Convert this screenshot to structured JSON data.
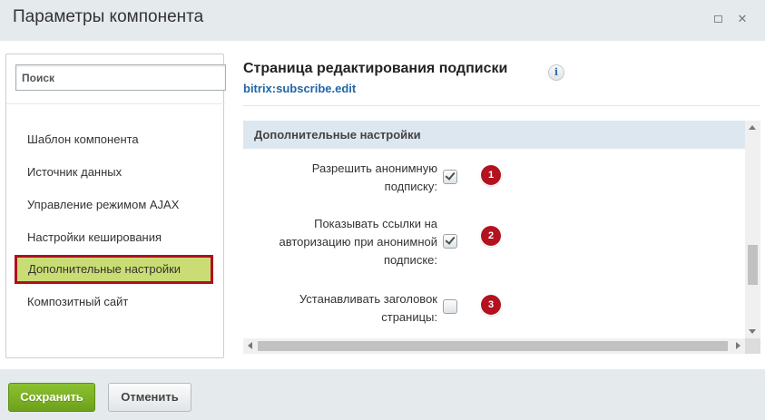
{
  "window": {
    "title": "Параметры компонента",
    "maximize_icon": "maximize-icon",
    "close_icon": "close-icon",
    "close_glyph": "✕"
  },
  "sidebar": {
    "search_placeholder": "Поиск",
    "items": [
      {
        "label": "Шаблон компонента"
      },
      {
        "label": "Источник данных"
      },
      {
        "label": "Управление режимом AJAX"
      },
      {
        "label": "Настройки кеширования"
      },
      {
        "label": "Дополнительные настройки",
        "active": true
      },
      {
        "label": "Композитный сайт"
      }
    ]
  },
  "component": {
    "title": "Страница редактирования подписки",
    "code": "bitrix:subscribe.edit",
    "info_glyph": "i"
  },
  "section": {
    "title": "Дополнительные настройки",
    "properties": [
      {
        "label_lines": [
          "Разрешить анонимную",
          "подписку:"
        ],
        "checked": true,
        "badge": "1"
      },
      {
        "label_lines": [
          "Показывать ссылки на",
          "авторизацию при анонимной",
          "подписке:"
        ],
        "checked": true,
        "badge": "2"
      },
      {
        "label_lines": [
          "Устанавливать заголовок",
          "страницы:"
        ],
        "checked": false,
        "badge": "3"
      }
    ]
  },
  "footer": {
    "save_label": "Сохранить",
    "cancel_label": "Отменить"
  },
  "colors": {
    "save_button": "#7bb225",
    "active_item_bg": "#c9dd74",
    "active_item_border": "#b0101e",
    "badge": "#b3121f",
    "section_header": "#dde7f0",
    "component_code": "#2167a6"
  }
}
